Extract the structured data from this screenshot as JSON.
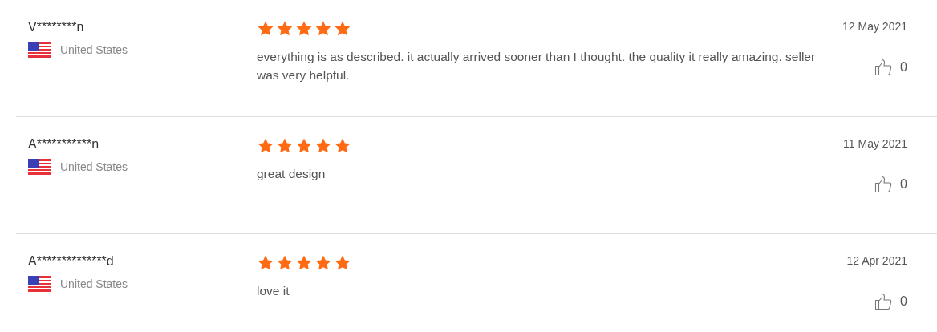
{
  "reviews": [
    {
      "name": "V********n",
      "country": "United States",
      "stars": 5,
      "text": "everything is as described. it actually arrived sooner than I thought. the quality it really amazing. seller was very helpful.",
      "date": "12 May 2021",
      "likes": "0"
    },
    {
      "name": "A***********n",
      "country": "United States",
      "stars": 5,
      "text": "great design",
      "date": "11 May 2021",
      "likes": "0"
    },
    {
      "name": "A**************d",
      "country": "United States",
      "stars": 5,
      "text": "love it",
      "date": "12 Apr 2021",
      "likes": "0"
    }
  ]
}
